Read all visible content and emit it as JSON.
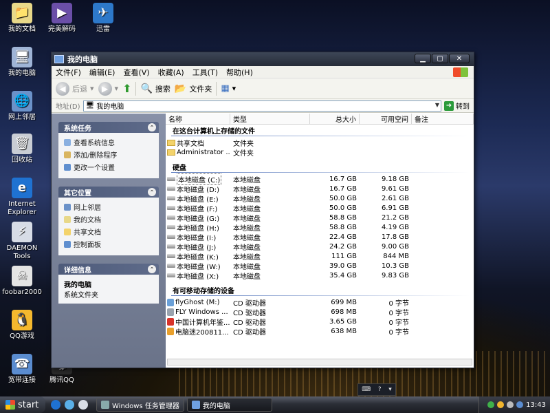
{
  "desktop": {
    "icons": [
      {
        "label": "我的文档"
      },
      {
        "label": "完美解码"
      },
      {
        "label": "迅雷"
      },
      {
        "label": "我的电脑"
      },
      {
        "label": "网上邻居"
      },
      {
        "label": "回收站"
      },
      {
        "label": "Internet Explorer"
      },
      {
        "label": "DAEMON Tools"
      },
      {
        "label": "foobar2000"
      },
      {
        "label": "QQ游戏"
      },
      {
        "label": "宽带连接"
      },
      {
        "label": "腾讯QQ"
      }
    ]
  },
  "window": {
    "title": "我的电脑",
    "menu": [
      "文件(F)",
      "编辑(E)",
      "查看(V)",
      "收藏(A)",
      "工具(T)",
      "帮助(H)"
    ],
    "toolbar": {
      "back": "后退",
      "search": "搜索",
      "folders": "文件夹"
    },
    "address": {
      "label": "地址(D)",
      "value": "我的电脑",
      "go": "转到"
    },
    "taskpane": {
      "system_tasks": {
        "title": "系统任务",
        "items": [
          "查看系统信息",
          "添加/删除程序",
          "更改一个设置"
        ]
      },
      "other_places": {
        "title": "其它位置",
        "items": [
          "网上邻居",
          "我的文档",
          "共享文档",
          "控制面板"
        ]
      },
      "details": {
        "title": "详细信息",
        "name": "我的电脑",
        "sub": "系统文件夹"
      }
    },
    "columns": {
      "name": "名称",
      "type": "类型",
      "total": "总大小",
      "free": "可用空间",
      "note": "备注"
    },
    "groups": {
      "stored": "在这台计算机上存储的文件",
      "drives": "硬盘",
      "removable": "有可移动存储的设备"
    },
    "stored_items": [
      {
        "name": "共享文档",
        "type": "文件夹"
      },
      {
        "name": "Administrator ...",
        "type": "文件夹"
      }
    ],
    "drives": [
      {
        "name": "本地磁盘 (C:)",
        "type": "本地磁盘",
        "total": "16.7 GB",
        "free": "9.18 GB"
      },
      {
        "name": "本地磁盘 (D:)",
        "type": "本地磁盘",
        "total": "16.7 GB",
        "free": "9.61 GB"
      },
      {
        "name": "本地磁盘 (E:)",
        "type": "本地磁盘",
        "total": "50.0 GB",
        "free": "2.61 GB"
      },
      {
        "name": "本地磁盘 (F:)",
        "type": "本地磁盘",
        "total": "50.0 GB",
        "free": "6.91 GB"
      },
      {
        "name": "本地磁盘 (G:)",
        "type": "本地磁盘",
        "total": "58.8 GB",
        "free": "21.2 GB"
      },
      {
        "name": "本地磁盘 (H:)",
        "type": "本地磁盘",
        "total": "58.8 GB",
        "free": "4.19 GB"
      },
      {
        "name": "本地磁盘 (I:)",
        "type": "本地磁盘",
        "total": "22.4 GB",
        "free": "17.8 GB"
      },
      {
        "name": "本地磁盘 (J:)",
        "type": "本地磁盘",
        "total": "24.2 GB",
        "free": "9.00 GB"
      },
      {
        "name": "本地磁盘 (K:)",
        "type": "本地磁盘",
        "total": "111 GB",
        "free": "844 MB"
      },
      {
        "name": "本地磁盘 (W:)",
        "type": "本地磁盘",
        "total": "39.0 GB",
        "free": "10.3 GB"
      },
      {
        "name": "本地磁盘 (X:)",
        "type": "本地磁盘",
        "total": "35.4 GB",
        "free": "9.83 GB"
      }
    ],
    "removable": [
      {
        "name": "flyGhost (M:)",
        "type": "CD 驱动器",
        "total": "699 MB",
        "free": "0 字节"
      },
      {
        "name": "FLY Windows ...",
        "type": "CD 驱动器",
        "total": "698 MB",
        "free": "0 字节"
      },
      {
        "name": "中国计算机年鉴...",
        "type": "CD 驱动器",
        "total": "3.65 GB",
        "free": "0 字节"
      },
      {
        "name": "电脑迷200811...",
        "type": "CD 驱动器",
        "total": "638 MB",
        "free": "0 字节"
      }
    ]
  },
  "taskbar": {
    "start": "start",
    "buttons": [
      "Windows 任务管理器",
      "我的电脑"
    ],
    "clock": "13:43"
  },
  "colors": {
    "taskpane": "#7b849b",
    "titlebar": "#2f3542",
    "accent": "#5d7dbf"
  }
}
